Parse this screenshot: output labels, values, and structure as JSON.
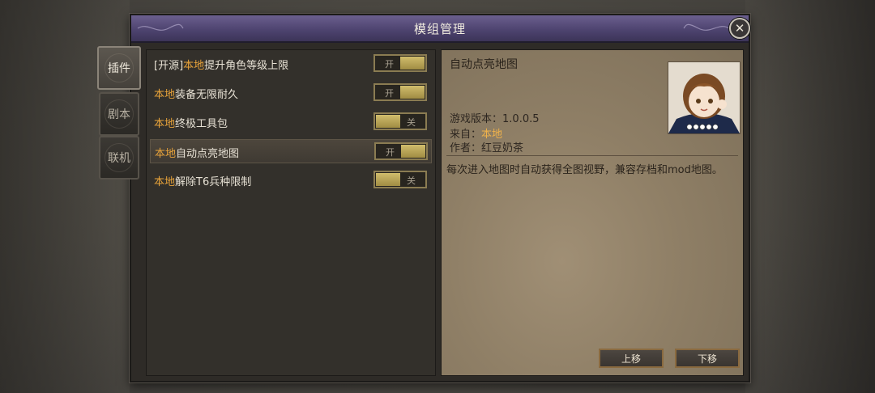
{
  "dialog": {
    "title": "模组管理",
    "close_glyph": "✕"
  },
  "side_tabs": [
    {
      "label": "插件",
      "active": true
    },
    {
      "label": "剧本",
      "active": false
    },
    {
      "label": "联机",
      "active": false
    }
  ],
  "mods": [
    {
      "prefix": "[开源]",
      "source": "本地",
      "name": "提升角色等级上限",
      "state_label": "开",
      "enabled": true,
      "selected": false
    },
    {
      "prefix": "",
      "source": "本地",
      "name": "装备无限耐久",
      "state_label": "开",
      "enabled": true,
      "selected": false
    },
    {
      "prefix": "",
      "source": "本地",
      "name": "终极工具包",
      "state_label": "关",
      "enabled": false,
      "selected": false
    },
    {
      "prefix": "",
      "source": "本地",
      "name": "自动点亮地图",
      "state_label": "开",
      "enabled": true,
      "selected": true
    },
    {
      "prefix": "",
      "source": "本地",
      "name": "解除T6兵种限制",
      "state_label": "关",
      "enabled": false,
      "selected": false
    }
  ],
  "detail": {
    "title": "自动点亮地图",
    "version_label": "游戏版本：",
    "version": "1.0.0.5",
    "from_label": "来自：",
    "from_value": "本地",
    "author_label": "作者：",
    "author": "红豆奶茶",
    "description": "每次进入地图时自动获得全图视野，兼容存档和mod地图。",
    "move_up_label": "上移",
    "move_down_label": "下移"
  },
  "colors": {
    "accent_source": "#e8a33a",
    "title_bar": "#564b7c",
    "toggle_knob": "#c4b060"
  }
}
